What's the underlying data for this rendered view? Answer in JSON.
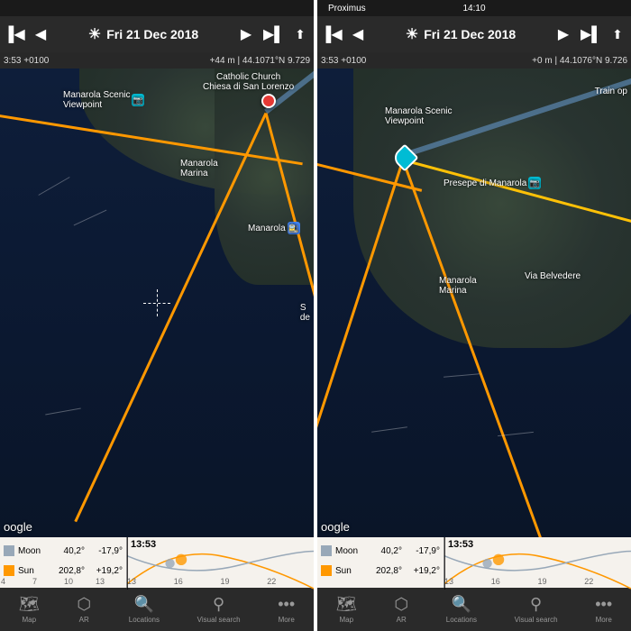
{
  "status": {
    "carrier": "Proximus",
    "time": "14:10"
  },
  "left": {
    "date": "Fri 21 Dec 2018",
    "local_time": "3:53 +0100",
    "elevation": "+44 m",
    "coords": "44.1071°N 9.729",
    "pois": {
      "viewpoint": "Manarola Scenic\nViewpoint",
      "church": "Catholic Church\nChiesa di San Lorenzo",
      "marina": "Manarola\nMarina",
      "station": "Manarola",
      "sd": "S\nde"
    },
    "attr": "oogle"
  },
  "right": {
    "date": "Fri 21 Dec 2018",
    "local_time": "3:53 +0100",
    "elevation": "+0 m",
    "coords": "44.1076°N 9.726",
    "pois": {
      "viewpoint": "Manarola Scenic\nViewpoint",
      "presepe": "Presepe di Manarola",
      "marina": "Manarola\nMarina",
      "belvedere": "Via Belvedere",
      "train": "Train op"
    },
    "attr": "oogle"
  },
  "ephemeris": {
    "moon": {
      "label": "Moon",
      "az": "40,2°",
      "alt": "-17,9°",
      "color": "#98a8b8"
    },
    "sun": {
      "label": "Sun",
      "az": "202,8°",
      "alt": "+19,2°",
      "color": "#ff9800"
    },
    "now_time": "13:53",
    "ticks": [
      "4",
      "7",
      "10",
      "13",
      "16",
      "19",
      "22"
    ]
  },
  "tabs": {
    "map": "Map",
    "ar": "AR",
    "locations": "Locations",
    "search": "Visual search",
    "more": "More"
  }
}
